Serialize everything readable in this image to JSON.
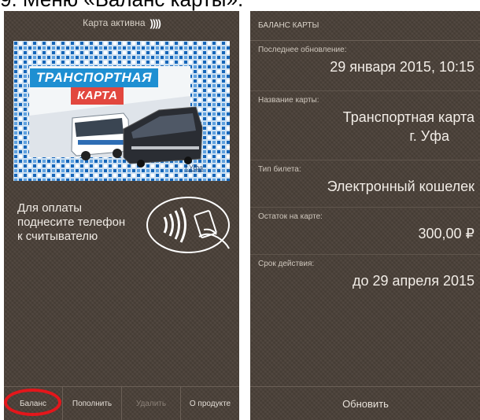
{
  "caption": "9. Меню «Баланс карты».",
  "left_screen": {
    "status": {
      "text": "Карта активна",
      "icon": "nfc-signal-icon",
      "icon_glyph": "))))"
    },
    "card": {
      "title_line1": "ТРАНСПОРТНАЯ",
      "title_line2": "КАРТА",
      "city": "г.Уфа"
    },
    "pay_instructions": [
      "Для оплаты",
      "поднесите телефон",
      "к считывателю"
    ],
    "bottom_tabs": [
      {
        "label": "Баланс",
        "enabled": true,
        "highlighted": true
      },
      {
        "label": "Пополнить",
        "enabled": true
      },
      {
        "label": "Удалить",
        "enabled": false
      },
      {
        "label": "О продукте",
        "enabled": true
      }
    ]
  },
  "right_screen": {
    "header": "БАЛАНС КАРТЫ",
    "fields": [
      {
        "label": "Последнее обновление:",
        "value": "29 января 2015, 10:15"
      },
      {
        "label": "Название карты:",
        "value": "Транспортная карта",
        "value2": "г. Уфа"
      },
      {
        "label": "Тип билета:",
        "value": "Электронный кошелек"
      },
      {
        "label": "Остаток на карте:",
        "value": "300,00 ₽"
      },
      {
        "label": "Срок действия:",
        "value": "до 29 апреля 2015"
      }
    ],
    "refresh_button": "Обновить"
  },
  "colors": {
    "background": "#4a4038",
    "highlight_ring": "#e4161b",
    "card_blue": "#1e8fd2",
    "card_red": "#e2473e"
  }
}
